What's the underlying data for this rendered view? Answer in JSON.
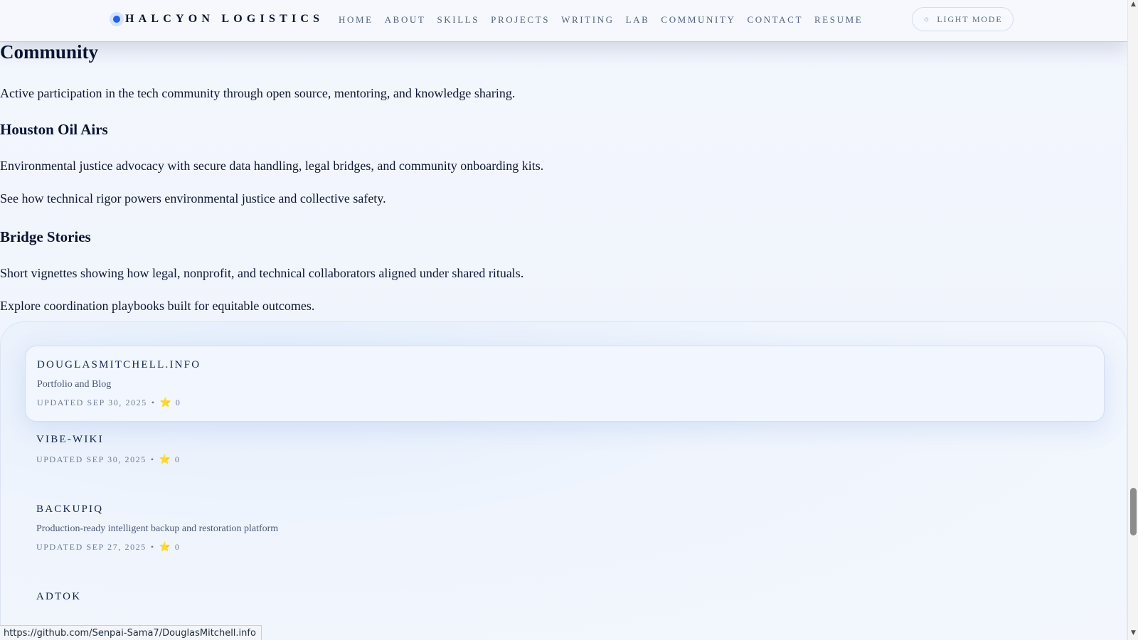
{
  "header": {
    "brand": "HALCYON LOGISTICS",
    "nav": [
      "HOME",
      "ABOUT",
      "SKILLS",
      "PROJECTS",
      "WRITING",
      "LAB",
      "COMMUNITY",
      "CONTACT",
      "RESUME"
    ],
    "mode_label": "LIGHT MODE",
    "mode_icon": "sun-icon"
  },
  "main": {
    "title": "Community",
    "intro": "Active participation in the tech community through open source, mentoring, and knowledge sharing.",
    "sections": [
      {
        "heading": "Houston Oil Airs",
        "lines": [
          "Environmental justice advocacy with secure data handling, legal bridges, and community onboarding kits.",
          "See how technical rigor powers environmental justice and collective safety."
        ]
      },
      {
        "heading": "Bridge Stories",
        "lines": [
          "Short vignettes showing how legal, nonprofit, and technical collaborators aligned under shared rituals.",
          "Explore coordination playbooks built for equitable outcomes."
        ]
      }
    ]
  },
  "repos": [
    {
      "name": "DOUGLASMITCHELL.INFO",
      "desc": "Portfolio and Blog",
      "updated": "UPDATED SEP 30, 2025",
      "sep": "•",
      "stars": "0"
    },
    {
      "name": "VIBE-WIKI",
      "desc": "",
      "updated": "UPDATED SEP 30, 2025",
      "sep": "•",
      "stars": "0"
    },
    {
      "name": "BACKUPIQ",
      "desc": "Production-ready intelligent backup and restoration platform",
      "updated": "UPDATED SEP 27, 2025",
      "sep": "•",
      "stars": "0"
    },
    {
      "name": "ADTOK",
      "desc": "",
      "updated": "",
      "sep": "",
      "stars": ""
    }
  ],
  "status_bar": {
    "url": "https://github.com/Senpai-Sama7/DouglasMitchell.info"
  },
  "colors": {
    "accent": "#1f63e6",
    "star": "#f2b824",
    "text": "#0b1733"
  }
}
